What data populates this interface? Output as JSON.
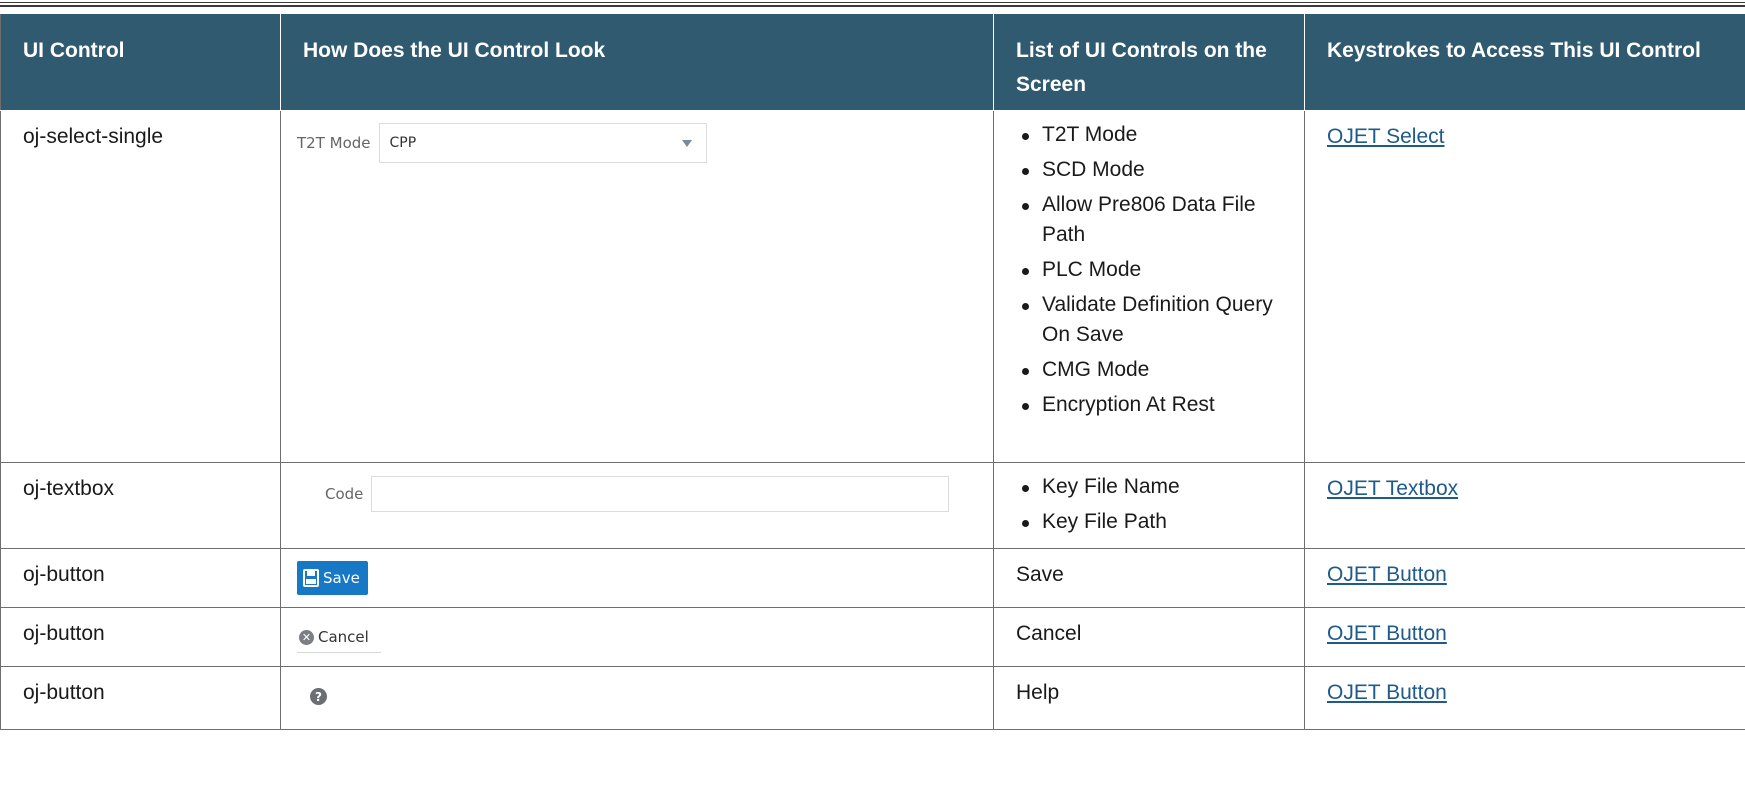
{
  "table": {
    "headers": [
      "UI Control",
      "How Does the UI Control Look",
      "List of UI Controls on the Screen",
      "Keystrokes to Access This UI Control"
    ],
    "rows": [
      {
        "control": "oj-select-single",
        "look": {
          "label": "T2T Mode",
          "value": "CPP",
          "icon": "caret-down-icon"
        },
        "list": [
          "T2T Mode",
          "SCD Mode",
          "Allow Pre806 Data File Path",
          "PLC Mode",
          "Validate Definition Query On Save",
          "CMG Mode",
          "Encryption At Rest"
        ],
        "link": "OJET Select"
      },
      {
        "control": "oj-textbox",
        "look": {
          "label": "Code",
          "value": ""
        },
        "list": [
          "Key File Name",
          "Key File Path"
        ],
        "link": "OJET Textbox"
      },
      {
        "control": "oj-button",
        "look": {
          "label": "Save",
          "icon": "floppy-disk-icon"
        },
        "list_text": "Save",
        "link": "OJET Button"
      },
      {
        "control": "oj-button",
        "look": {
          "label": "Cancel",
          "icon": "cancel-circle-icon"
        },
        "list_text": "Cancel",
        "link": "OJET Button"
      },
      {
        "control": "oj-button",
        "look": {
          "icon": "help-question-icon",
          "glyph": "?"
        },
        "list_text": "Help",
        "link": "OJET Button"
      }
    ]
  },
  "colors": {
    "header_bg": "#2f5a70",
    "link": "#1e5a8a",
    "save_button": "#1778c6"
  }
}
